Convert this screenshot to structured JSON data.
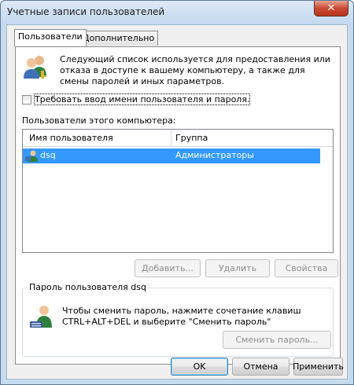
{
  "window": {
    "title": "Учетные записи пользователей",
    "close_symbol": "✕"
  },
  "tabs": [
    {
      "label": "Пользователи",
      "active": true
    },
    {
      "label": "Дополнительно",
      "active": false
    }
  ],
  "users_tab": {
    "info_text": "Следующий список используется для предоставления или отказа в доступе к вашему компьютеру, а также для смены паролей и иных параметров.",
    "require_login_checkbox": {
      "label": "Требовать ввод имени пользователя и пароля.",
      "checked": false
    },
    "users_list_label": "Пользователи этого компьютера:",
    "columns": [
      "Имя пользователя",
      "Группа"
    ],
    "rows": [
      {
        "name": "dsq",
        "group": "Администраторы",
        "selected": true
      }
    ],
    "buttons": {
      "add": "Добавить...",
      "remove": "Удалить",
      "properties": "Свойства"
    },
    "password_group": {
      "title": "Пароль пользователя dsq",
      "text": "Чтобы сменить пароль, нажмите сочетание клавиш CTRL+ALT+DEL и выберите \"Сменить пароль\"",
      "change_button": "Сменить пароль..."
    }
  },
  "footer": {
    "ok": "OK",
    "cancel": "Отмена",
    "apply": "Применить"
  },
  "icons": [
    "users-icon",
    "user-icon",
    "user-keyboard-icon",
    "close-icon"
  ],
  "colors": {
    "selection": "#3399ff",
    "window_frame": "#c7dbef",
    "close_button": "#c94a35"
  }
}
